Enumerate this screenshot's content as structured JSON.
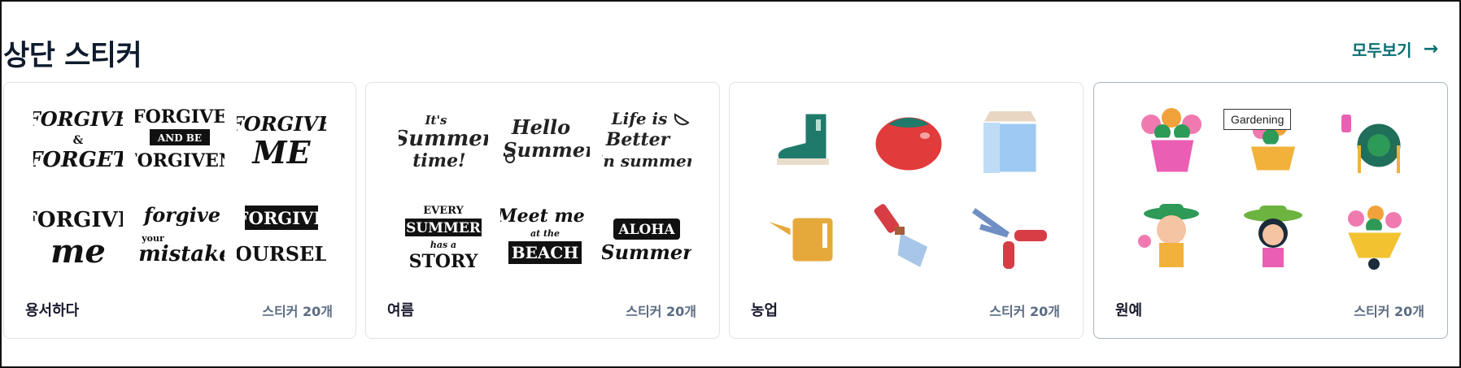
{
  "section": {
    "title": "상단 스티커",
    "see_all": "모두보기"
  },
  "cards": [
    {
      "name": "용서하다",
      "count": "스티커 20개",
      "stickers": [
        [
          "FORGIVE",
          "&",
          "FORGET"
        ],
        [
          "FORGIVE",
          "AND BE",
          "FORGIVEN"
        ],
        [
          "FORGIVE",
          "ME"
        ],
        [
          "FORGIVE",
          "me"
        ],
        [
          "forgive",
          "your",
          "mistake"
        ],
        [
          "FORGIVE",
          "YOURSELF"
        ]
      ]
    },
    {
      "name": "여름",
      "count": "스티커 20개",
      "stickers": [
        [
          "It's",
          "Summer",
          "time!"
        ],
        [
          "Hello",
          "Summer"
        ],
        [
          "Life is",
          "Better",
          "in summer"
        ],
        [
          "EVERY",
          "SUMMER",
          "has a",
          "STORY"
        ],
        [
          "Meet me",
          "at the",
          "BEACH"
        ],
        [
          "ALOHA",
          "Summer"
        ]
      ]
    },
    {
      "name": "농업",
      "count": "스티커 20개"
    },
    {
      "name": "원예",
      "count": "스티커 20개"
    }
  ],
  "tooltip": "Gardening",
  "colors": {
    "accent": "#0b6e73",
    "count_text": "#5b6b82",
    "card_border": "#dfe3e8"
  },
  "icons": [
    "arrow-right-icon",
    "boot-icon",
    "tomato-icon",
    "milk-carton-icon",
    "watering-can-icon",
    "trowel-icon",
    "pruning-shears-icon",
    "flower-pot-icon",
    "flower-basket-icon",
    "hose-reel-icon",
    "gardener-man-icon",
    "gardener-woman-icon",
    "flower-wheelbarrow-icon"
  ]
}
